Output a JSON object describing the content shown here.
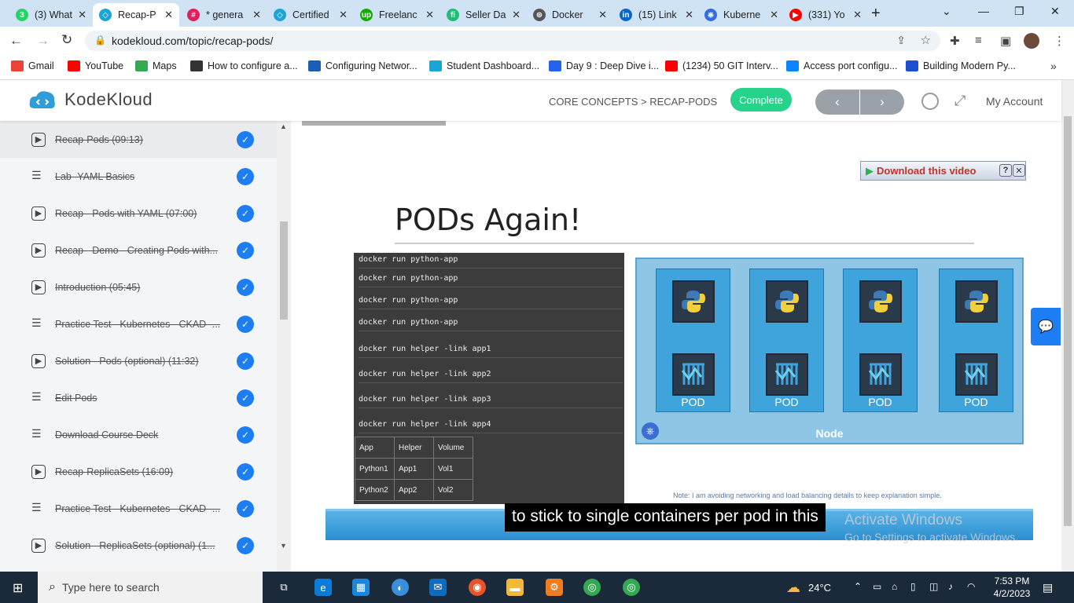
{
  "browser": {
    "tabs": [
      {
        "title": "(3) What",
        "color": "#25d366",
        "glyph": "3"
      },
      {
        "title": "Recap-P",
        "color": "#1aa5d6",
        "glyph": "◇"
      },
      {
        "title": "* genera",
        "color": "#e01e5a",
        "glyph": "#"
      },
      {
        "title": "Certified",
        "color": "#1aa5d6",
        "glyph": "◇"
      },
      {
        "title": "Freelanc",
        "color": "#14a800",
        "glyph": "up"
      },
      {
        "title": "Seller Da",
        "color": "#1dbf73",
        "glyph": "fi"
      },
      {
        "title": "Docker",
        "color": "#555555",
        "glyph": "⊛"
      },
      {
        "title": "(15) Link",
        "color": "#0a66c2",
        "glyph": "in"
      },
      {
        "title": "Kuberne",
        "color": "#326ce5",
        "glyph": "⎈"
      },
      {
        "title": "(331) Yo",
        "color": "#ff0000",
        "glyph": "▶"
      }
    ],
    "url": "kodekloud.com/topic/recap-pods/",
    "bookmarks": [
      {
        "label": "Gmail",
        "color": "#ea4335"
      },
      {
        "label": "YouTube",
        "color": "#ff0000"
      },
      {
        "label": "Maps",
        "color": "#34a853"
      },
      {
        "label": "How to configure a...",
        "color": "#333333"
      },
      {
        "label": "Configuring Networ...",
        "color": "#1a5eb8"
      },
      {
        "label": "Student Dashboard...",
        "color": "#1aa5d6"
      },
      {
        "label": "Day 9 : Deep Dive i...",
        "color": "#2463eb"
      },
      {
        "label": "(1234) 50 GIT Interv...",
        "color": "#ff0000"
      },
      {
        "label": "Access port configu...",
        "color": "#0a84ff"
      },
      {
        "label": "Building Modern Py...",
        "color": "#1b4fcf"
      }
    ]
  },
  "site": {
    "logo_text": "KodeKloud",
    "breadcrumb": "CORE CONCEPTS > RECAP-PODS",
    "complete_label": "Complete",
    "prev_label": "‹",
    "next_label": "›",
    "account_label": "My Account"
  },
  "sidebar": {
    "lessons": [
      {
        "title": "Recap-Pods (09:13)",
        "type": "video",
        "current": true
      },
      {
        "title": "Lab- YAML Basics",
        "type": "doc",
        "current": false
      },
      {
        "title": "Recap - Pods with YAML (07:00)",
        "type": "video",
        "current": false
      },
      {
        "title": "Recap - Demo - Creating Pods with...",
        "type": "video",
        "current": false
      },
      {
        "title": "Introduction (05:45)",
        "type": "video",
        "current": false
      },
      {
        "title": "Practice Test - Kubernetes - CKAD -...",
        "type": "doc",
        "current": false
      },
      {
        "title": "Solution - Pods (optional) (11:32)",
        "type": "video",
        "current": false
      },
      {
        "title": "Edit Pods",
        "type": "doc",
        "current": false
      },
      {
        "title": "Download Course Deck",
        "type": "doc",
        "current": false
      },
      {
        "title": "Recap-ReplicaSets (16:09)",
        "type": "video",
        "current": false
      },
      {
        "title": "Practice Test - Kubernetes - CKAD -...",
        "type": "doc",
        "current": false
      },
      {
        "title": "Solution - ReplicaSets (optional) (1...",
        "type": "video",
        "current": false
      }
    ]
  },
  "video": {
    "download_label": "Download this video",
    "slide_title": "PODs Again!",
    "commands": [
      "docker run python-app",
      "docker run python-app",
      "docker run python-app",
      "docker run python-app",
      "docker run helper -link app1",
      "docker run helper -link app2",
      "docker run helper -link app3",
      "docker run helper -link app4"
    ],
    "table": [
      [
        "App",
        "Helper",
        "Volume"
      ],
      [
        "Python1",
        "App1",
        "Vol1"
      ],
      [
        "Python2",
        "App2",
        "Vol2"
      ]
    ],
    "pod_label": "POD",
    "node_label": "Node",
    "note": "Note: I am avoiding networking and load balancing details to keep explanation simple.",
    "caption": "to stick to single containers per pod in this"
  },
  "watermark": {
    "line1": "Activate Windows",
    "line2": "Go to Settings to activate Windows."
  },
  "taskbar": {
    "search_placeholder": "Type here to search",
    "weather": "24°C",
    "time": "7:53 PM",
    "date": "4/2/2023"
  }
}
